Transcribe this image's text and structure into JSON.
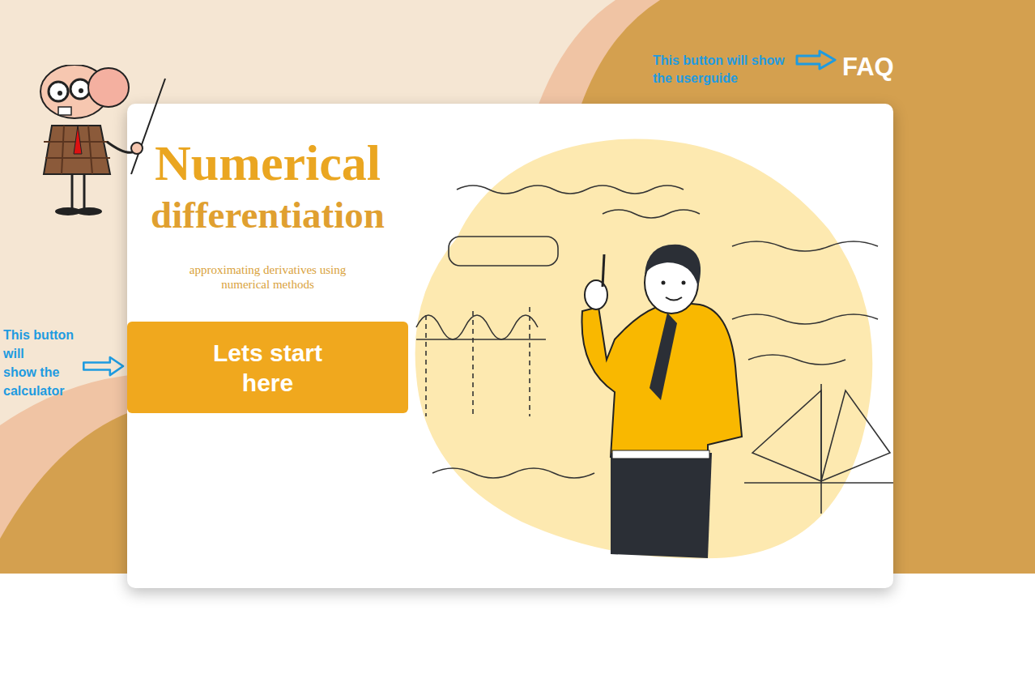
{
  "annotations": {
    "faq_note": "This button will show\nthe userguide",
    "start_note": "This button\nwill\nshow the\ncalculator"
  },
  "nav": {
    "faq": "FAQ"
  },
  "hero": {
    "title": "Numerical",
    "title_second": "differentiation",
    "subtitle": "approximating derivatives using numerical methods",
    "button": "Lets start here"
  }
}
